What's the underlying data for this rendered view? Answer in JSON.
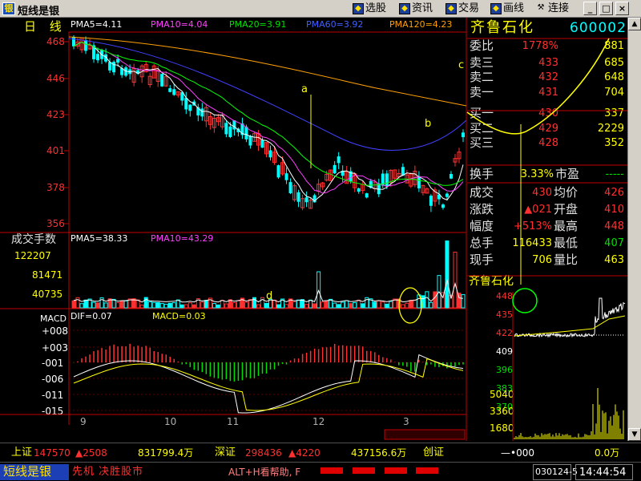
{
  "window": {
    "title": "短线是银"
  },
  "toolbar": [
    {
      "label": "选股",
      "icon": "stock-select-icon"
    },
    {
      "label": "资讯",
      "icon": "news-icon"
    },
    {
      "label": "交易",
      "icon": "trade-icon"
    },
    {
      "label": "画线",
      "icon": "draw-line-icon"
    },
    {
      "label": "连接",
      "icon": "connect-icon"
    }
  ],
  "window_buttons": {
    "minimize": "_",
    "maximize": "□",
    "close": "×"
  },
  "kline": {
    "period_label": "日 线",
    "ma": [
      {
        "label": "PMA5=4.11",
        "color": "#ffffff"
      },
      {
        "label": "PMA10=4.04",
        "color": "#ff40ff"
      },
      {
        "label": "PMA20=3.91",
        "color": "#00ff00"
      },
      {
        "label": "PMA60=3.92",
        "color": "#4040ff"
      },
      {
        "label": "PMA120=4.23",
        "color": "#ffa000"
      }
    ],
    "y_ticks": [
      "468",
      "446",
      "423",
      "401",
      "378",
      "356"
    ],
    "annotations": [
      "a",
      "b",
      "c"
    ]
  },
  "volume": {
    "title": "成交手数",
    "ma": [
      {
        "label": "PMA5=38.33",
        "color": "#ffffff"
      },
      {
        "label": "PMA10=43.29",
        "color": "#ff40ff"
      }
    ],
    "y_ticks": [
      "122207",
      "81471",
      "40735"
    ],
    "annotation": "d"
  },
  "macd": {
    "title": "MACD",
    "dif_label": "DIF=0.07",
    "macd_label": "MACD=0.03",
    "y_ticks": [
      "+008",
      "+003",
      "-001",
      "-006",
      "-011",
      "-015"
    ]
  },
  "x_axis": [
    "9",
    "10",
    "11",
    "12",
    "3"
  ],
  "quote": {
    "name": "齐鲁石化",
    "code": "600002",
    "rows": [
      {
        "label": "委比",
        "v1": "1778%",
        "v1c": "#ff3030",
        "v2": "881",
        "v2c": "#ffff00"
      },
      {
        "label": "卖三",
        "v1": "433",
        "v1c": "#ff3030",
        "v2": "685",
        "v2c": "#ffff00"
      },
      {
        "label": "卖二",
        "v1": "432",
        "v1c": "#ff3030",
        "v2": "648",
        "v2c": "#ffff00"
      },
      {
        "label": "卖一",
        "v1": "431",
        "v1c": "#ff3030",
        "v2": "704",
        "v2c": "#ffff00"
      },
      {
        "label": "买一",
        "v1": "430",
        "v1c": "#ff3030",
        "v2": "337",
        "v2c": "#ffff00"
      },
      {
        "label": "买二",
        "v1": "429",
        "v1c": "#ff3030",
        "v2": "2229",
        "v2c": "#ffff00"
      },
      {
        "label": "买三",
        "v1": "428",
        "v1c": "#ff3030",
        "v2": "352",
        "v2c": "#ffff00"
      }
    ],
    "turnover": {
      "label": "换手",
      "value": "3.33%",
      "label2": "市盈",
      "value2": "-----"
    },
    "stats": [
      {
        "l1": "成交",
        "v1": "430",
        "v1c": "#ff3030",
        "l2": "均价",
        "v2": "426",
        "v2c": "#ff3030"
      },
      {
        "l1": "涨跌",
        "v1": "▲021",
        "v1c": "#ff3030",
        "l2": "开盘",
        "v2": "410",
        "v2c": "#ff3030"
      },
      {
        "l1": "幅度",
        "v1": "+513%",
        "v1c": "#ff3030",
        "l2": "最高",
        "v2": "448",
        "v2c": "#ff3030"
      },
      {
        "l1": "总手",
        "v1": "116433",
        "v1c": "#ffff00",
        "l2": "最低",
        "v2": "407",
        "v2c": "#00e000"
      },
      {
        "l1": "现手",
        "v1": "706",
        "v1c": "#ffff00",
        "l2": "量比",
        "v2": "463",
        "v2c": "#ffff00"
      }
    ]
  },
  "intraday": {
    "title": "齐鲁石化",
    "price_ticks": [
      "448",
      "435",
      "422",
      "409",
      "396",
      "383",
      "370"
    ],
    "vol_ticks": [
      "5040",
      "3360",
      "1680"
    ]
  },
  "status": {
    "sh_label": "上证",
    "sh_index": "147570",
    "sh_change": "▲2508",
    "sh_amount": "831799.4万",
    "sz_label": "深证",
    "sz_index": "298436",
    "sz_change": "▲4220",
    "sz_amount": "437156.6万",
    "board_label": "创证",
    "board_arrow": "—•000",
    "board_amount": "0.0万"
  },
  "footer": {
    "brand": "短线是银",
    "ticker": "先机 决胜股市",
    "help": "ALT+H看帮助, F",
    "date": "030124-5",
    "time": "14:44:54"
  }
}
